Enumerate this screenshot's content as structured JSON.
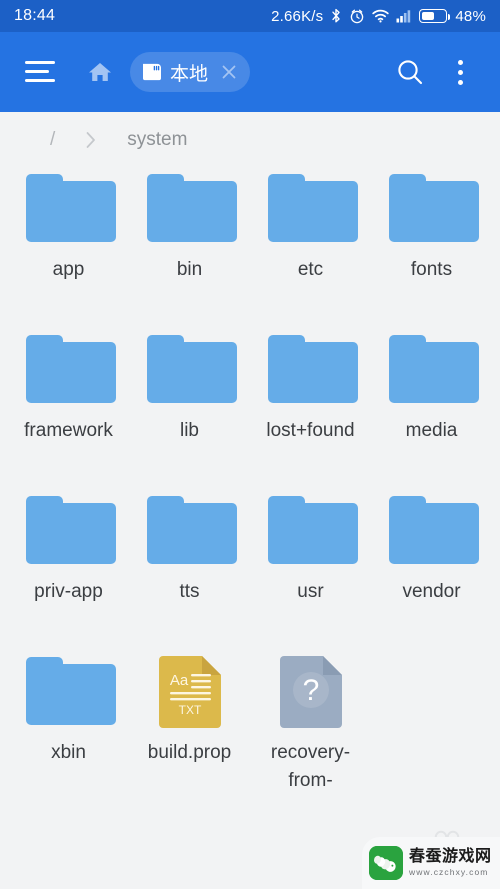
{
  "statusbar": {
    "clock": "18:44",
    "net_speed": "2.66K/s",
    "battery_percent": "48%",
    "battery_level": 48,
    "icons": [
      "bluetooth-icon",
      "alarm-clock-icon",
      "wifi-icon",
      "cellular-signal-icon",
      "battery-icon"
    ],
    "bg_color": "#1c60c6"
  },
  "toolbar": {
    "menu_icon": "hamburger-menu-icon",
    "home_icon": "home-icon",
    "chip": {
      "icon": "sd-card-icon",
      "label": "本地",
      "close_icon": "close-icon"
    },
    "search_icon": "search-icon",
    "overflow_icon": "more-vertical-icon",
    "bg_color": "#2573e2"
  },
  "breadcrumb": {
    "root": "/",
    "separator": "›",
    "current": "system"
  },
  "grid": {
    "items": [
      {
        "name": "app",
        "type": "folder"
      },
      {
        "name": "bin",
        "type": "folder"
      },
      {
        "name": "etc",
        "type": "folder"
      },
      {
        "name": "fonts",
        "type": "folder"
      },
      {
        "name": "framework",
        "type": "folder"
      },
      {
        "name": "lib",
        "type": "folder"
      },
      {
        "name": "lost+found",
        "type": "folder"
      },
      {
        "name": "media",
        "type": "folder"
      },
      {
        "name": "priv-app",
        "type": "folder"
      },
      {
        "name": "tts",
        "type": "folder"
      },
      {
        "name": "usr",
        "type": "folder"
      },
      {
        "name": "vendor",
        "type": "folder"
      },
      {
        "name": "xbin",
        "type": "folder"
      },
      {
        "name": "build.prop",
        "type": "text-file",
        "badge": "TXT",
        "sample": "Aa"
      },
      {
        "name": "recovery-from-",
        "type": "unknown-file",
        "badge": "?"
      }
    ],
    "folder_color": "#65ace8",
    "text_file_color": "#dcb94b",
    "unknown_file_color": "#9bacc2",
    "label_color": "#3b3e42"
  },
  "watermark": {
    "title": "春蚕游戏网",
    "url": "www.czchxy.com",
    "logo_color": "#2aa33f"
  }
}
